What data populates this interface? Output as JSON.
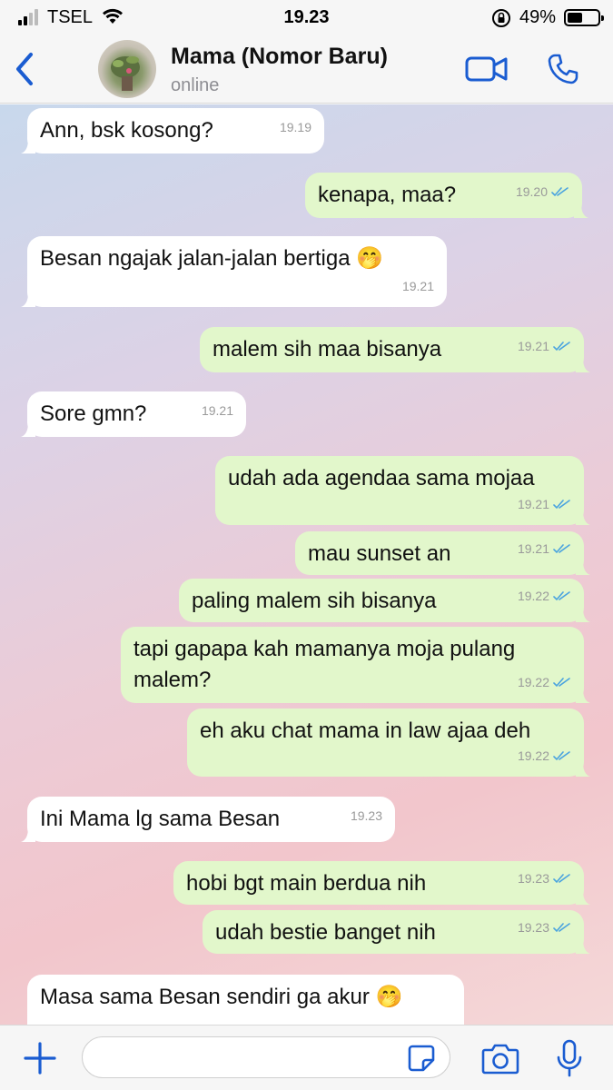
{
  "status_bar": {
    "carrier": "TSEL",
    "time": "19.23",
    "battery_percent": "49%",
    "battery_level": 0.49
  },
  "header": {
    "contact_name": "Mama (Nomor Baru)",
    "status": "online"
  },
  "colors": {
    "accent": "#1a5cd1",
    "incoming_bubble": "#ffffff",
    "outgoing_bubble": "#e2f7cb",
    "read_ticks": "#4aa3df"
  },
  "messages": [
    {
      "dir": "in",
      "text": "Ann, bsk kosong?",
      "time": "19.19"
    },
    {
      "dir": "out",
      "text": "kenapa, maa?",
      "time": "19.20",
      "read": true
    },
    {
      "dir": "in",
      "text": "Besan ngajak jalan-jalan bertiga 🤭",
      "time": "19.21"
    },
    {
      "dir": "out",
      "text": "malem sih maa bisanya",
      "time": "19.21",
      "read": true
    },
    {
      "dir": "in",
      "text": "Sore gmn?",
      "time": "19.21"
    },
    {
      "dir": "out",
      "text": "udah ada agendaa sama mojaa",
      "time": "19.21",
      "read": true
    },
    {
      "dir": "out",
      "text": "mau sunset an",
      "time": "19.21",
      "read": true
    },
    {
      "dir": "out",
      "text": "paling malem sih bisanya",
      "time": "19.22",
      "read": true
    },
    {
      "dir": "out",
      "text": "tapi gapapa kah mamanya moja pulang malem?",
      "time": "19.22",
      "read": true
    },
    {
      "dir": "out",
      "text": "eh aku chat mama in law ajaa deh",
      "time": "19.22",
      "read": true
    },
    {
      "dir": "in",
      "text": "Ini Mama lg sama Besan",
      "time": "19.23"
    },
    {
      "dir": "out",
      "text": "hobi bgt main berdua nih",
      "time": "19.23",
      "read": true
    },
    {
      "dir": "out",
      "text": "udah bestie banget nih",
      "time": "19.23",
      "read": true
    },
    {
      "dir": "in",
      "text": "Masa sama Besan sendiri ga akur 🤭",
      "time": ""
    }
  ],
  "input": {
    "placeholder": "",
    "value": ""
  }
}
